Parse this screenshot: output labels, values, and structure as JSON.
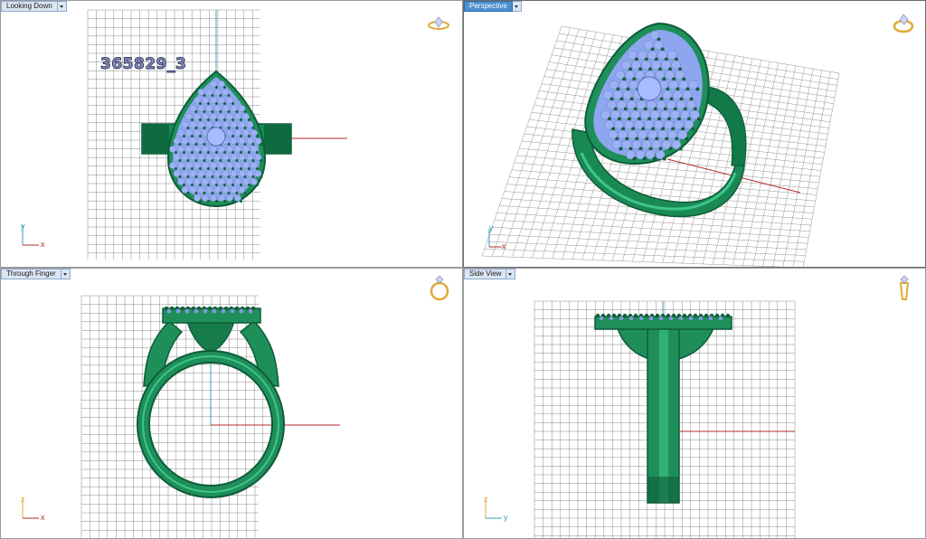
{
  "viewports": [
    {
      "title": "Looking Down",
      "axis_h": "x",
      "axis_v": "y",
      "thumbnail": "ring-top-thumbnail-icon"
    },
    {
      "title": "Perspective",
      "axis_h": "x",
      "axis_v": "y",
      "thumbnail": "ring-perspective-thumbnail-icon"
    },
    {
      "title": "Through Finger",
      "axis_h": "x",
      "axis_v": "z",
      "thumbnail": "ring-front-thumbnail-icon"
    },
    {
      "title": "Side View",
      "axis_h": "y",
      "axis_v": "z",
      "thumbnail": "ring-side-thumbnail-icon"
    }
  ],
  "model_label": "365829_3",
  "colors": {
    "metal": "#1f8f5a",
    "metal_dark": "#0d5c38",
    "metal_light": "#3fc58a",
    "gem": "#8ea6ef",
    "gem_light": "#c9d6ff",
    "prong": "#13603b",
    "grid": "#7a7a7a",
    "x_axis": "#b52a2a",
    "y_axis": "#3aa0b0",
    "active_tab": "#4b8fcf",
    "thumb_gold": "#e1a93a"
  }
}
